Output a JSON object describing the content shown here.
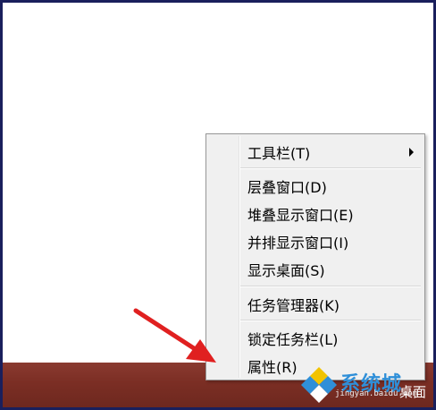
{
  "context_menu": {
    "items": [
      {
        "label": "工具栏(T)",
        "has_submenu": true
      },
      {
        "label": "层叠窗口(D)"
      },
      {
        "label": "堆叠显示窗口(E)"
      },
      {
        "label": "并排显示窗口(I)"
      },
      {
        "label": "显示桌面(S)"
      },
      {
        "label": "任务管理器(K)"
      },
      {
        "label": "锁定任务栏(L)"
      },
      {
        "label": "属性(R)"
      }
    ]
  },
  "taskbar": {
    "right_text": "桌面"
  },
  "watermark": {
    "brand": "系统城",
    "url": "jingyan.baidu.com"
  },
  "colors": {
    "taskbar": "#7b2e24",
    "menu_bg": "#f0f0f0",
    "arrow": "#e02020",
    "frame_border": "#1a1f5c"
  }
}
